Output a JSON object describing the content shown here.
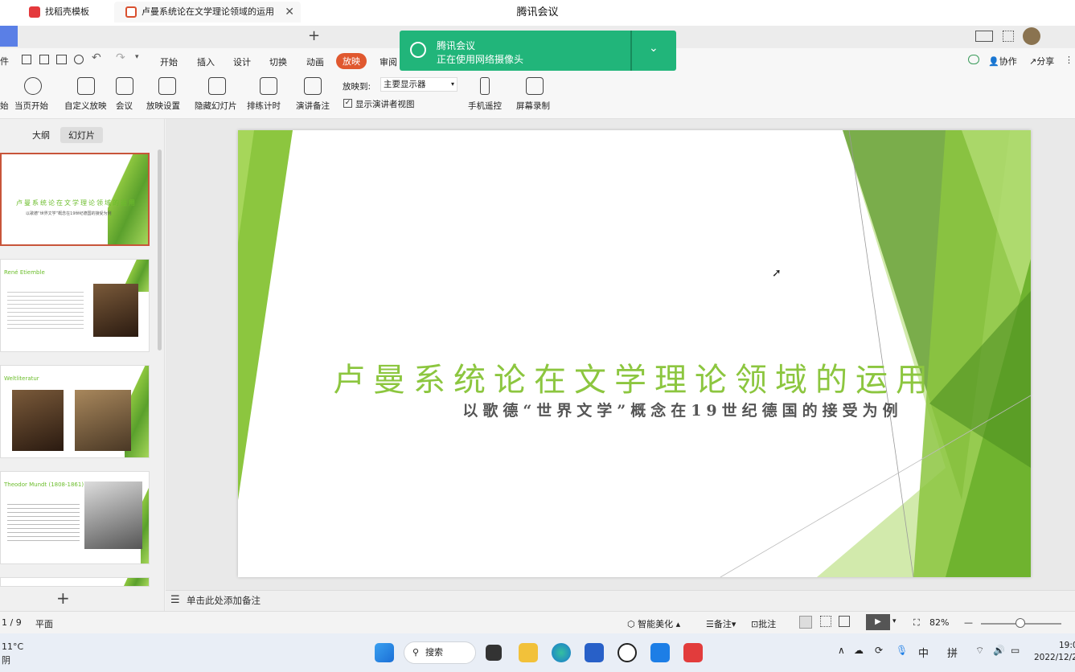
{
  "window": {
    "title": "腾讯会议"
  },
  "tabs": [
    {
      "label": "找稻壳模板"
    },
    {
      "label": "卢曼系统论在文学理论领域的运用",
      "close": "✕"
    }
  ],
  "tab_plus": "+",
  "menu": {
    "file": "件",
    "items": [
      "开始",
      "插入",
      "设计",
      "切换",
      "动画",
      "放映",
      "审阅"
    ],
    "collab": "协作",
    "share": "分享"
  },
  "ribbon": {
    "buttons": [
      "始",
      "当页开始",
      "自定义放映",
      "会议",
      "放映设置",
      "隐藏幻灯片",
      "排练计时",
      "演讲备注"
    ],
    "play_to_label": "放映到:",
    "play_to_value": "主要显示器",
    "presenter_view": "显示演讲者视图",
    "mobile_remote": "手机遥控",
    "screen_record": "屏幕录制"
  },
  "left_panel": {
    "tab_outline": "大纲",
    "tab_slides": "幻灯片",
    "thumbs": [
      {
        "title": "卢曼系统论在文学理论领域的运用",
        "subtitle": "以歌德“世界文学”概念在19世纪德国的接受为例"
      },
      {
        "title": "René Etiemble"
      },
      {
        "title": "Weltliteratur"
      },
      {
        "title": "Theodor Mundt (1808-1861)"
      }
    ],
    "add": "+"
  },
  "slide": {
    "title": "卢曼系统论在文学理论领域的运用",
    "subtitle": "以歌德“世界文学”概念在19世纪德国的接受为例"
  },
  "notes": {
    "placeholder": "单击此处添加备注"
  },
  "status": {
    "page": "1 / 9",
    "view": "平面",
    "smart": "智能美化",
    "notes": "备注",
    "comments": "批注",
    "zoom": "82%"
  },
  "toast": {
    "title": "腾讯会议",
    "message": "正在使用网络摄像头"
  },
  "taskbar": {
    "weather_temp": "11°C",
    "weather_desc": "阴",
    "search": "搜索",
    "ime_cn": "中",
    "ime_py": "拼",
    "time": "19:0",
    "date": "2022/12/2"
  },
  "colors": {
    "accent_green": "#8cc63f",
    "slideshow_tab": "#e0582f",
    "toast_bg": "#21b57a"
  }
}
